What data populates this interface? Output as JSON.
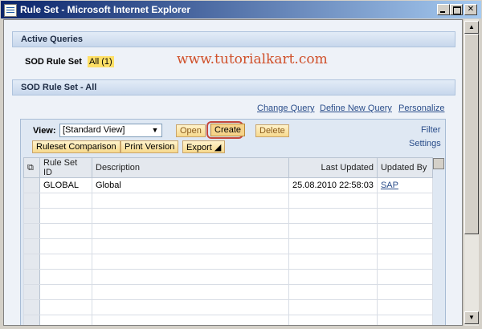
{
  "window": {
    "title": "Rule Set - Microsoft Internet Explorer"
  },
  "active_queries": {
    "header": "Active Queries",
    "label": "SOD Rule Set",
    "badge": "All (1)",
    "watermark": "www.tutorialkart.com"
  },
  "section_all": {
    "header": "SOD Rule Set - All"
  },
  "query_links": {
    "change": "Change Query",
    "define": "Define New Query",
    "personalize": "Personalize"
  },
  "toolbar": {
    "view_label": "View:",
    "view_value": "[Standard View]",
    "open": "Open",
    "create": "Create",
    "delete": "Delete",
    "filter": "Filter",
    "settings": "Settings",
    "ruleset_comparison": "Ruleset Comparison",
    "print_version": "Print Version",
    "export": "Export"
  },
  "table": {
    "columns": [
      "Rule Set ID",
      "Description",
      "Last Updated",
      "Updated By"
    ],
    "rows": [
      {
        "id": "GLOBAL",
        "description": "Global",
        "last_updated": "25.08.2010 22:58:03",
        "updated_by": "SAP"
      }
    ]
  },
  "icons": {
    "app": "ie-page-icon",
    "select_all": "table-select-icon"
  },
  "colors": {
    "accent": "#c5473b",
    "link": "#2a4d8a",
    "watermark": "#d0502a"
  }
}
